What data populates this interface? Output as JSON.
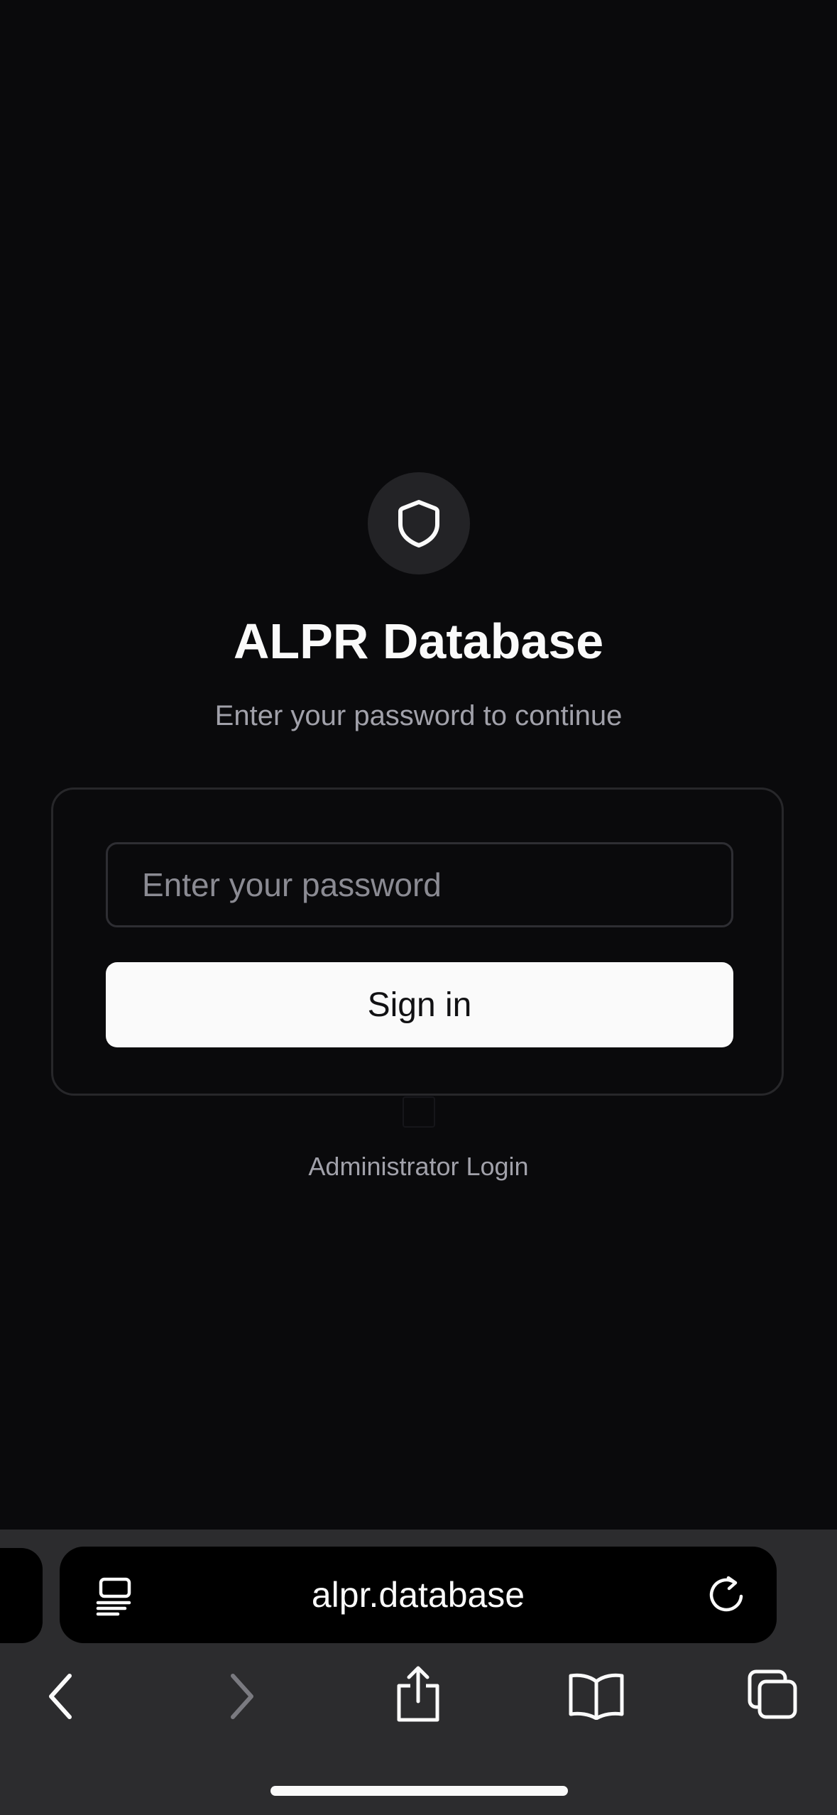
{
  "app": {
    "title": "ALPR Database",
    "subtitle": "Enter your password to continue"
  },
  "login_form": {
    "password_placeholder": "Enter your password",
    "password_value": "",
    "signin_label": "Sign in"
  },
  "admin_link": {
    "label": "Administrator Login"
  },
  "browser": {
    "url": "alpr.database",
    "icons": {
      "reader": "reader-mode-icon",
      "reload": "reload-icon",
      "back": "back-icon",
      "forward": "forward-icon",
      "share": "share-icon",
      "bookmarks": "bookmarks-icon",
      "tabs": "tabs-icon"
    }
  },
  "colors": {
    "background": "#0a0a0c",
    "card_border": "#27272a",
    "button_bg": "#fafafa",
    "muted_text": "#a1a1aa",
    "toolbar": "#2c2c2e"
  }
}
